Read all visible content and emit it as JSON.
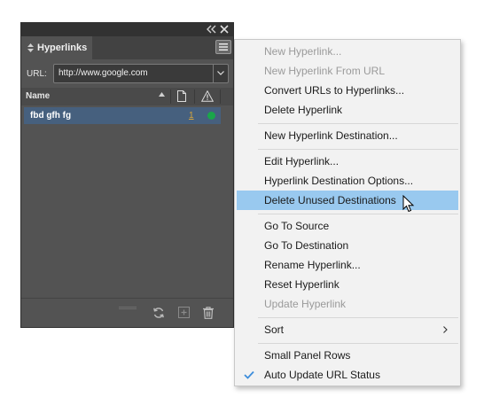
{
  "panel": {
    "tab_label": "Hyperlinks",
    "url_label": "URL:",
    "url_value": "http://www.google.com",
    "column_name": "Name",
    "rows": [
      {
        "name": "fbd gfh fg",
        "page": "1",
        "status": "green"
      }
    ],
    "icons": {
      "collapse": "double-chevron-icon",
      "close": "close-icon",
      "menu": "hamburger-icon",
      "refresh": "refresh-icon",
      "new": "new-hyperlink-icon",
      "delete": "trash-icon"
    },
    "colors": {
      "selection": "#46607e",
      "status_ok": "#1aa64a",
      "page_link": "#d7a53b"
    }
  },
  "menu": {
    "items": [
      {
        "label": "New Hyperlink...",
        "disabled": true
      },
      {
        "label": "New Hyperlink From URL",
        "disabled": true
      },
      {
        "label": "Convert URLs to Hyperlinks...",
        "disabled": false
      },
      {
        "label": "Delete Hyperlink",
        "disabled": false
      },
      {
        "label": "New Hyperlink Destination...",
        "disabled": false
      },
      {
        "label": "Edit Hyperlink...",
        "disabled": false
      },
      {
        "label": "Hyperlink Destination Options...",
        "disabled": false
      },
      {
        "label": "Delete Unused Destinations",
        "disabled": false,
        "highlighted": true
      },
      {
        "label": "Go To Source",
        "disabled": false
      },
      {
        "label": "Go To Destination",
        "disabled": false
      },
      {
        "label": "Rename Hyperlink...",
        "disabled": false
      },
      {
        "label": "Reset Hyperlink",
        "disabled": false
      },
      {
        "label": "Update Hyperlink",
        "disabled": true
      },
      {
        "label": "Sort",
        "disabled": false,
        "submenu": true
      },
      {
        "label": "Small Panel Rows",
        "disabled": false
      },
      {
        "label": "Auto Update URL Status",
        "disabled": false,
        "checked": true
      }
    ],
    "colors": {
      "highlight": "#99c9ef",
      "check": "#3c8ddb"
    }
  }
}
